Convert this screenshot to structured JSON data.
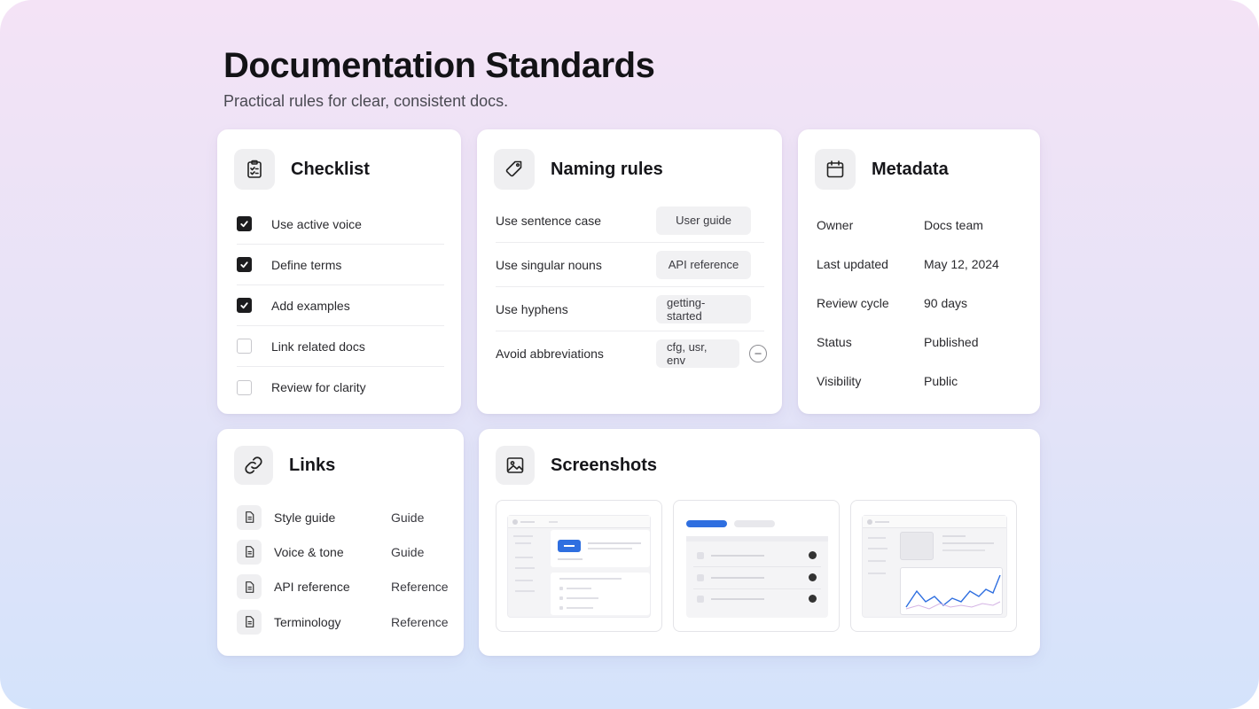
{
  "page": {
    "title": "Documentation Standards",
    "subtitle": "Practical rules for clear, consistent docs."
  },
  "colors": {
    "background_top": "#f4e3f6",
    "background_bottom": "#d4e3fb",
    "accent_blue": "#2f6fe0",
    "checked": "#1c1c1e"
  },
  "checklist": {
    "title": "Checklist",
    "icon": "clipboard-check-icon",
    "items": [
      {
        "label": "Use active voice",
        "checked": true
      },
      {
        "label": "Define terms",
        "checked": true
      },
      {
        "label": "Add examples",
        "checked": true
      },
      {
        "label": "Link related docs",
        "checked": false
      },
      {
        "label": "Review for clarity",
        "checked": false
      }
    ]
  },
  "naming": {
    "title": "Naming rules",
    "icon": "tag-icon",
    "rules": [
      {
        "label": "Use sentence case",
        "example": "User guide"
      },
      {
        "label": "Use singular nouns",
        "example": "API reference"
      },
      {
        "label": "Use hyphens",
        "example": "getting-started"
      },
      {
        "label": "Avoid abbreviations",
        "example": "cfg, usr, env",
        "has_remove": true
      }
    ]
  },
  "metadata": {
    "title": "Metadata",
    "icon": "calendar-icon",
    "rows": [
      {
        "key": "Owner",
        "value": "Docs team"
      },
      {
        "key": "Last updated",
        "value": "May 12, 2024"
      },
      {
        "key": "Review cycle",
        "value": "90 days"
      },
      {
        "key": "Status",
        "value": "Published"
      },
      {
        "key": "Visibility",
        "value": "Public"
      }
    ]
  },
  "links": {
    "title": "Links",
    "icon": "link-icon",
    "items": [
      {
        "label": "Style guide",
        "type": "Guide"
      },
      {
        "label": "Voice & tone",
        "type": "Guide"
      },
      {
        "label": "API reference",
        "type": "Reference"
      },
      {
        "label": "Terminology",
        "type": "Reference"
      }
    ]
  },
  "screenshots": {
    "title": "Screenshots",
    "icon": "image-icon",
    "thumbnails": [
      "settings-screen",
      "task-list-screen",
      "analytics-chart-screen"
    ]
  }
}
